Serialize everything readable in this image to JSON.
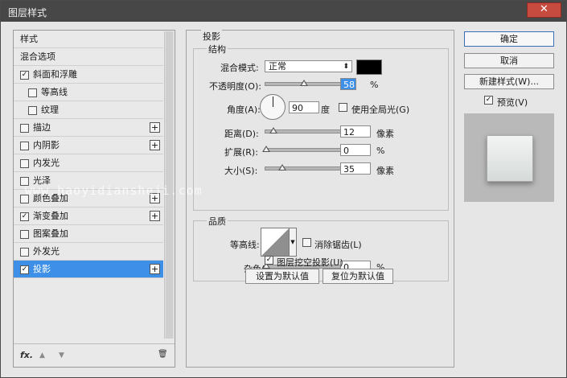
{
  "window": {
    "title": "图层样式",
    "close_label": "✕"
  },
  "left_panel": {
    "items": [
      {
        "label": "样式",
        "checkbox": false,
        "checked": false,
        "plus": false,
        "selected": false,
        "indent": false
      },
      {
        "label": "混合选项",
        "checkbox": false,
        "checked": false,
        "plus": false,
        "selected": false,
        "indent": false
      },
      {
        "label": "斜面和浮雕",
        "checkbox": true,
        "checked": true,
        "plus": false,
        "selected": false,
        "indent": false
      },
      {
        "label": "等高线",
        "checkbox": true,
        "checked": false,
        "plus": false,
        "selected": false,
        "indent": true
      },
      {
        "label": "纹理",
        "checkbox": true,
        "checked": false,
        "plus": false,
        "selected": false,
        "indent": true
      },
      {
        "label": "描边",
        "checkbox": true,
        "checked": false,
        "plus": true,
        "selected": false,
        "indent": false
      },
      {
        "label": "内阴影",
        "checkbox": true,
        "checked": false,
        "plus": true,
        "selected": false,
        "indent": false
      },
      {
        "label": "内发光",
        "checkbox": true,
        "checked": false,
        "plus": false,
        "selected": false,
        "indent": false
      },
      {
        "label": "光泽",
        "checkbox": true,
        "checked": false,
        "plus": false,
        "selected": false,
        "indent": false
      },
      {
        "label": "颜色叠加",
        "checkbox": true,
        "checked": false,
        "plus": true,
        "selected": false,
        "indent": false
      },
      {
        "label": "渐变叠加",
        "checkbox": true,
        "checked": true,
        "plus": true,
        "selected": false,
        "indent": false
      },
      {
        "label": "图案叠加",
        "checkbox": true,
        "checked": false,
        "plus": false,
        "selected": false,
        "indent": false
      },
      {
        "label": "外发光",
        "checkbox": true,
        "checked": false,
        "plus": false,
        "selected": false,
        "indent": false
      },
      {
        "label": "投影",
        "checkbox": true,
        "checked": true,
        "plus": true,
        "selected": true,
        "indent": false
      }
    ],
    "footer": {
      "fx": "fx.",
      "up": "▲",
      "down": "▼",
      "trash": "🗑"
    }
  },
  "drop_shadow": {
    "title": "投影",
    "structure": {
      "title": "结构",
      "blend_mode_label": "混合模式:",
      "blend_mode_value": "正常",
      "opacity_label": "不透明度(O):",
      "opacity_value": "58",
      "opacity_unit": "%",
      "angle_label": "角度(A):",
      "angle_value": "90",
      "angle_unit": "度",
      "global_light_label": "使用全局光(G)",
      "distance_label": "距离(D):",
      "distance_value": "12",
      "distance_unit": "像素",
      "spread_label": "扩展(R):",
      "spread_value": "0",
      "spread_unit": "%",
      "size_label": "大小(S):",
      "size_value": "35",
      "size_unit": "像素"
    },
    "quality": {
      "title": "品质",
      "contour_label": "等高线:",
      "antialias_label": "消除锯齿(L)",
      "noise_label": "杂色(N):",
      "noise_value": "0",
      "noise_unit": "%"
    },
    "knockout_label": "图层挖空投影(U)",
    "make_default_label": "设置为默认值",
    "reset_default_label": "复位为默认值"
  },
  "right": {
    "ok_label": "确定",
    "cancel_label": "取消",
    "new_style_label": "新建样式(W)...",
    "preview_label": "预览(V)"
  },
  "watermark": "www.haoyidiansheji.com",
  "colors": {
    "selection": "#3d8fe8",
    "shadow_color": "#000000"
  }
}
